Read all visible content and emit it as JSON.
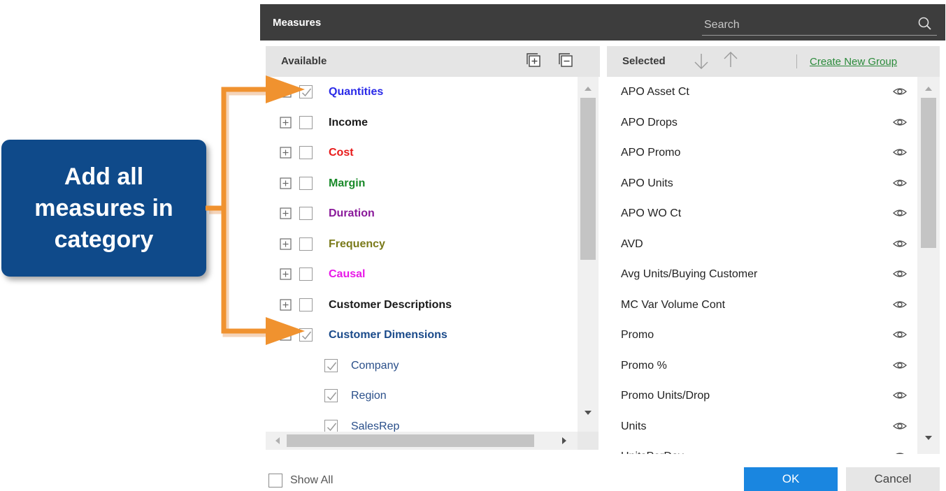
{
  "dialog": {
    "title": "Measures",
    "search_placeholder": "Search"
  },
  "available": {
    "header": "Available",
    "items": [
      {
        "label": "Quantities",
        "type": "category",
        "color": "#2a2ae8",
        "checked": true
      },
      {
        "label": "Income",
        "type": "category",
        "color": "#1a1a1a",
        "checked": false
      },
      {
        "label": "Cost",
        "type": "category",
        "color": "#e81a1a",
        "checked": false
      },
      {
        "label": "Margin",
        "type": "category",
        "color": "#1a8a2a",
        "checked": false
      },
      {
        "label": "Duration",
        "type": "category",
        "color": "#8a1a9a",
        "checked": false
      },
      {
        "label": "Frequency",
        "type": "category",
        "color": "#7a7a1a",
        "checked": false
      },
      {
        "label": "Causal",
        "type": "category",
        "color": "#e81ae8",
        "checked": false
      },
      {
        "label": "Customer Descriptions",
        "type": "category",
        "color": "#1a1a1a",
        "checked": false
      },
      {
        "label": "Customer Dimensions",
        "type": "category",
        "color": "#1a4a8a",
        "checked": true
      },
      {
        "label": "Company",
        "type": "child",
        "checked": true
      },
      {
        "label": "Region",
        "type": "child",
        "checked": true
      },
      {
        "label": "SalesRep",
        "type": "child",
        "checked": true
      }
    ]
  },
  "selected": {
    "header": "Selected",
    "create_group_link": "Create New Group",
    "items": [
      "APO Asset Ct",
      "APO Drops",
      "APO Promo",
      "APO Units",
      "APO WO Ct",
      "AVD",
      "Avg Units/Buying Customer",
      "MC Var Volume Cont",
      "Promo",
      "Promo %",
      "Promo Units/Drop",
      "Units",
      "UnitsPerDay"
    ]
  },
  "footer": {
    "show_all_label": "Show All",
    "ok_label": "OK",
    "cancel_label": "Cancel"
  },
  "callout": {
    "lines": [
      "Add all",
      "measures in",
      "category"
    ],
    "color": "#0f4a8a",
    "arrow_color": "#f0922f"
  },
  "colors": {
    "titlebar": "#3d3d3d",
    "ok_button": "#1a86e0",
    "link": "#2a8a3a"
  },
  "icons": [
    "search-icon",
    "expand-all-icon",
    "collapse-all-icon",
    "sort-down-icon",
    "sort-up-icon",
    "eye-icon",
    "plus-box-icon",
    "check-icon"
  ]
}
